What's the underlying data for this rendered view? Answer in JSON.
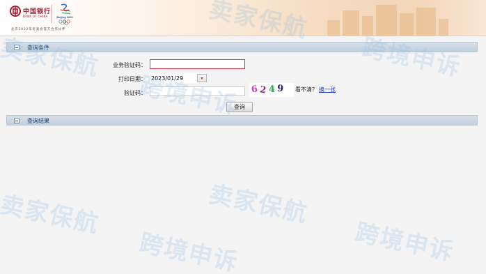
{
  "header": {
    "bank_name_cn": "中国银行",
    "bank_name_en": "BANK OF CHINA",
    "olympic_text": "Beijing 2022",
    "partner_text": "北京2022年冬奥会官方合作伙伴"
  },
  "query_panel": {
    "title": "查询条件",
    "business_code_label": "业务验证码：",
    "business_code_value": "",
    "print_date_label": "打印日期：",
    "print_date_value": "2023/01/29",
    "captcha_label": "验证码：",
    "captcha_value": "",
    "captcha_chars": [
      "6",
      "2",
      "4",
      "9"
    ],
    "captcha_colors": [
      "#d63cb1",
      "#9c1c7a",
      "#2ea84a",
      "#1f1f6e"
    ],
    "hint_text": "看不清？",
    "refresh_link": "换一张",
    "submit_label": "查询"
  },
  "result_panel": {
    "title": "查询结果"
  },
  "watermark": {
    "text_a": "卖家保航",
    "text_b": "跨境申诉",
    "text_c": "跨境申诉"
  },
  "colors": {
    "brand_red": "#a6192e",
    "panel_bar": "#c9d5e1",
    "link_blue": "#1a3cc7",
    "invalid_border": "#d2384a"
  }
}
